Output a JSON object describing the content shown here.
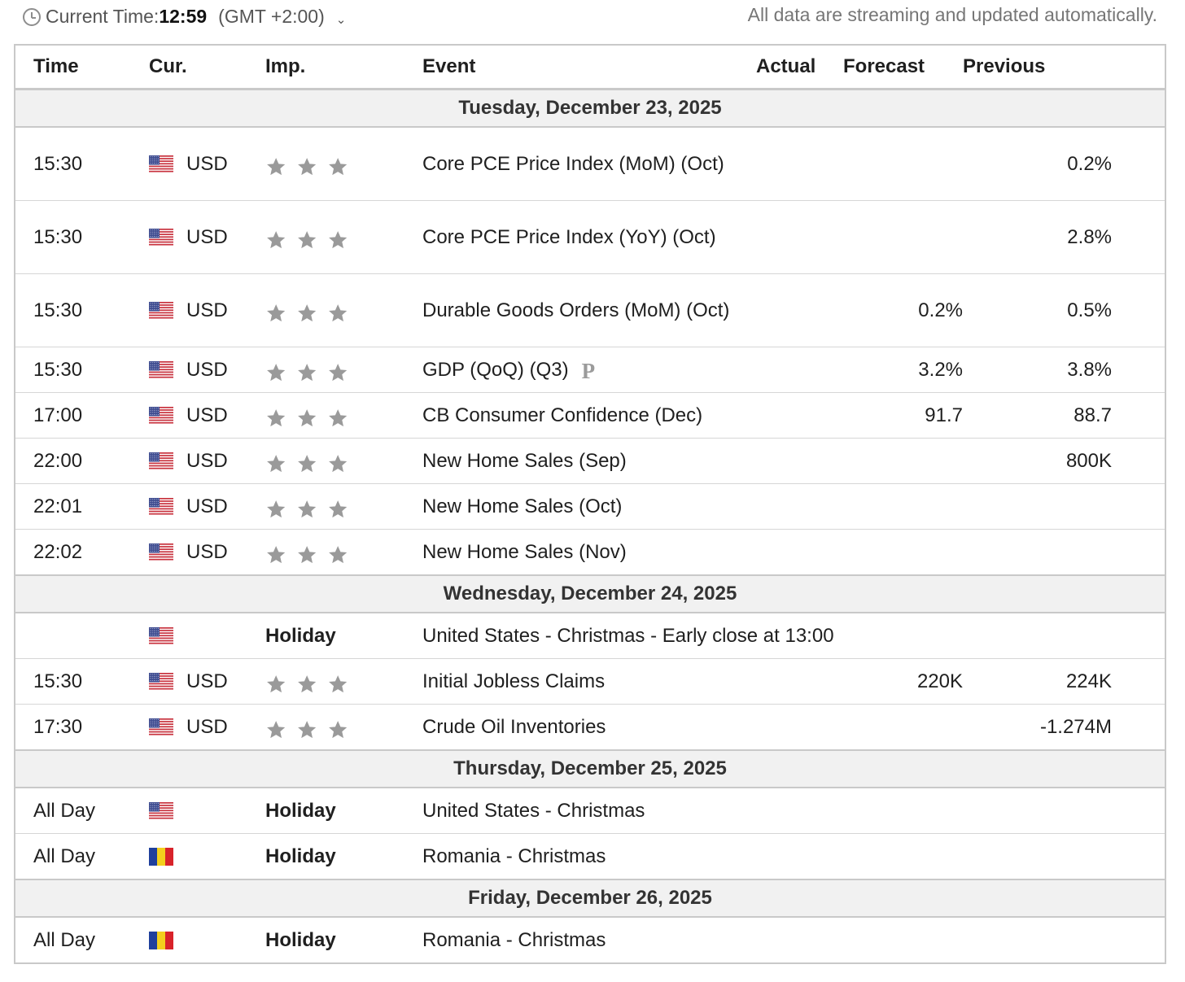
{
  "header": {
    "current_time_label": "Current Time:",
    "current_time": "12:59",
    "timezone": "(GMT +2:00)",
    "streaming_note": "All data are streaming and updated automatically."
  },
  "columns": {
    "time": "Time",
    "currency": "Cur.",
    "importance": "Imp.",
    "event": "Event",
    "actual": "Actual",
    "forecast": "Forecast",
    "previous": "Previous"
  },
  "days": [
    {
      "date": "Tuesday, December 23, 2025",
      "events": [
        {
          "time": "15:30",
          "flag": "us",
          "currency": "USD",
          "importance": "3-stars",
          "event": "Core PCE Price Index (MoM) (Oct)",
          "actual": "",
          "forecast": "",
          "previous": "0.2%",
          "tall": true
        },
        {
          "time": "15:30",
          "flag": "us",
          "currency": "USD",
          "importance": "3-stars",
          "event": "Core PCE Price Index (YoY) (Oct)",
          "actual": "",
          "forecast": "",
          "previous": "2.8%",
          "tall": true
        },
        {
          "time": "15:30",
          "flag": "us",
          "currency": "USD",
          "importance": "3-stars",
          "event": "Durable Goods Orders (MoM) (Oct)",
          "actual": "",
          "forecast": "0.2%",
          "previous": "0.5%",
          "tall": true
        },
        {
          "time": "15:30",
          "flag": "us",
          "currency": "USD",
          "importance": "3-stars",
          "event": "GDP (QoQ) (Q3)",
          "actual": "",
          "forecast": "3.2%",
          "previous": "3.8%",
          "prelim": "P"
        },
        {
          "time": "17:00",
          "flag": "us",
          "currency": "USD",
          "importance": "3-stars",
          "event": "CB Consumer Confidence (Dec)",
          "actual": "",
          "forecast": "91.7",
          "previous": "88.7"
        },
        {
          "time": "22:00",
          "flag": "us",
          "currency": "USD",
          "importance": "3-stars",
          "event": "New Home Sales (Sep)",
          "actual": "",
          "forecast": "",
          "previous": "800K"
        },
        {
          "time": "22:01",
          "flag": "us",
          "currency": "USD",
          "importance": "3-stars",
          "event": "New Home Sales (Oct)",
          "actual": "",
          "forecast": "",
          "previous": ""
        },
        {
          "time": "22:02",
          "flag": "us",
          "currency": "USD",
          "importance": "3-stars",
          "event": "New Home Sales (Nov)",
          "actual": "",
          "forecast": "",
          "previous": ""
        }
      ]
    },
    {
      "date": "Wednesday, December 24, 2025",
      "events": [
        {
          "time": "",
          "flag": "us",
          "currency": "",
          "importance": "Holiday",
          "event": "United States - Christmas - Early close at 13:00",
          "actual": "",
          "forecast": "",
          "previous": ""
        },
        {
          "time": "15:30",
          "flag": "us",
          "currency": "USD",
          "importance": "3-stars",
          "event": "Initial Jobless Claims",
          "actual": "",
          "forecast": "220K",
          "previous": "224K"
        },
        {
          "time": "17:30",
          "flag": "us",
          "currency": "USD",
          "importance": "3-stars",
          "event": "Crude Oil Inventories",
          "actual": "",
          "forecast": "",
          "previous": "-1.274M"
        }
      ]
    },
    {
      "date": "Thursday, December 25, 2025",
      "events": [
        {
          "time": "All Day",
          "flag": "ro",
          "currency": "",
          "importance": "Holiday",
          "event": "United States - Christmas",
          "actual": "",
          "forecast": "",
          "previous": "",
          "flagOverride": "us"
        },
        {
          "time": "All Day",
          "flag": "ro",
          "currency": "",
          "importance": "Holiday",
          "event": "Romania - Christmas",
          "actual": "",
          "forecast": "",
          "previous": ""
        }
      ]
    },
    {
      "date": "Friday, December 26, 2025",
      "events": [
        {
          "time": "All Day",
          "flag": "ro",
          "currency": "",
          "importance": "Holiday",
          "event": "Romania - Christmas",
          "actual": "",
          "forecast": "",
          "previous": ""
        }
      ]
    }
  ],
  "colors": {
    "star_inactive": "#9a9a9a",
    "day_header_bg": "#f1f1f1"
  }
}
